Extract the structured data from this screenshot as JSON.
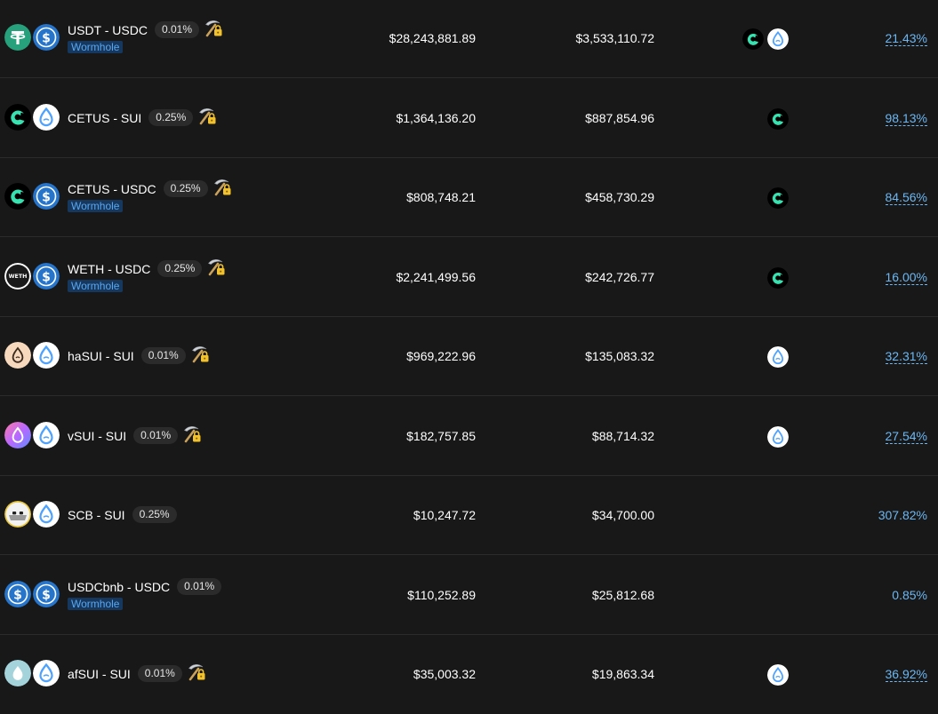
{
  "rows": [
    {
      "pair": "USDT - USDC",
      "fee": "0.01%",
      "badge": "Wormhole",
      "tvl": "$28,243,881.89",
      "volume": "$3,533,110.72",
      "apr": "21.43%",
      "token1": "usdt-icon",
      "token2": "usdc-icon",
      "rewards": [
        "cetus-icon",
        "sui-icon"
      ],
      "mining": true
    },
    {
      "pair": "CETUS - SUI",
      "fee": "0.25%",
      "badge": "",
      "tvl": "$1,364,136.20",
      "volume": "$887,854.96",
      "apr": "98.13%",
      "token1": "cetus-icon",
      "token2": "sui-icon",
      "rewards": [
        "cetus-icon"
      ],
      "mining": true
    },
    {
      "pair": "CETUS - USDC",
      "fee": "0.25%",
      "badge": "Wormhole",
      "tvl": "$808,748.21",
      "volume": "$458,730.29",
      "apr": "84.56%",
      "token1": "cetus-icon",
      "token2": "usdc-icon",
      "rewards": [
        "cetus-icon"
      ],
      "mining": true
    },
    {
      "pair": "WETH - USDC",
      "fee": "0.25%",
      "badge": "Wormhole",
      "tvl": "$2,241,499.56",
      "volume": "$242,726.77",
      "apr": "16.00%",
      "token1": "weth-icon",
      "token2": "usdc-icon",
      "weth_label": "WETH",
      "rewards": [
        "cetus-icon"
      ],
      "mining": true
    },
    {
      "pair": "haSUI - SUI",
      "fee": "0.01%",
      "badge": "",
      "tvl": "$969,222.96",
      "volume": "$135,083.32",
      "apr": "32.31%",
      "token1": "hasui-icon",
      "token2": "sui-icon",
      "rewards": [
        "sui-icon"
      ],
      "mining": true
    },
    {
      "pair": "vSUI - SUI",
      "fee": "0.01%",
      "badge": "",
      "tvl": "$182,757.85",
      "volume": "$88,714.32",
      "apr": "27.54%",
      "token1": "vsui-icon",
      "token2": "sui-icon",
      "rewards": [
        "sui-icon"
      ],
      "mining": true
    },
    {
      "pair": "SCB - SUI",
      "fee": "0.25%",
      "badge": "",
      "tvl": "$10,247.72",
      "volume": "$34,700.00",
      "apr": "307.82%",
      "token1": "scb-icon",
      "token2": "sui-icon",
      "rewards": [],
      "mining": false
    },
    {
      "pair": "USDCbnb - USDC",
      "fee": "0.01%",
      "badge": "Wormhole",
      "tvl": "$110,252.89",
      "volume": "$25,812.68",
      "apr": "0.85%",
      "token1": "usdc-icon",
      "token2": "usdc-icon",
      "rewards": [],
      "mining": false
    },
    {
      "pair": "afSUI - SUI",
      "fee": "0.01%",
      "badge": "",
      "tvl": "$35,003.32",
      "volume": "$19,863.34",
      "apr": "36.92%",
      "token1": "afsui-icon",
      "token2": "sui-icon",
      "rewards": [
        "sui-icon"
      ],
      "mining": true
    }
  ],
  "colors": {
    "background": "#181818",
    "divider": "#2b2b2b",
    "apr": "#6db7f2",
    "badge_bg": "#16385f",
    "badge_text": "#5aa7ef",
    "usdt": "#26a17b",
    "usdc": "#2775ca",
    "sui": "#4da2ff",
    "cetus": "#38e2b0"
  }
}
